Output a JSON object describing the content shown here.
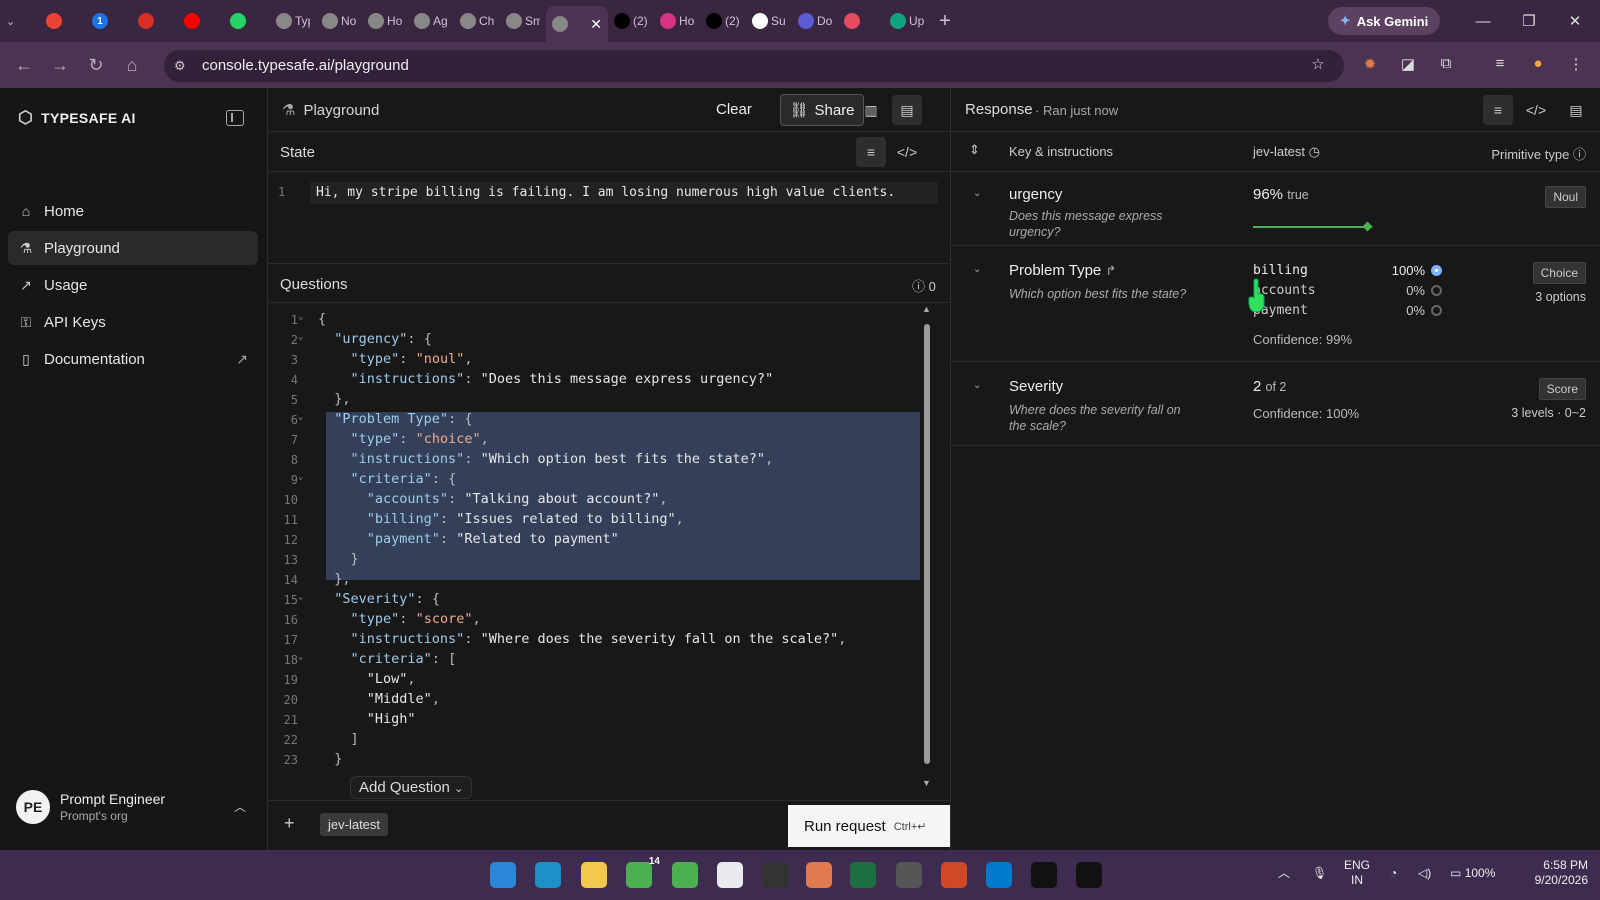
{
  "browser": {
    "tabs": [
      {
        "icon": "gmail-icon",
        "label": "",
        "color": "#ea4335"
      },
      {
        "icon": "badge-icon",
        "label": "",
        "color": "#1a73e8",
        "glyph": "1"
      },
      {
        "icon": "chrome-icon",
        "label": "",
        "color": "#d93025"
      },
      {
        "icon": "youtube-icon",
        "label": "",
        "color": "#ff0000"
      },
      {
        "icon": "whatsapp-icon",
        "label": "",
        "color": "#25d366"
      },
      {
        "icon": "openai-icon",
        "label": "Typ",
        "color": "#888888"
      },
      {
        "icon": "openai-icon",
        "label": "No",
        "color": "#888888"
      },
      {
        "icon": "openai-icon",
        "label": "Ho",
        "color": "#888888"
      },
      {
        "icon": "openai-icon",
        "label": "Age",
        "color": "#888888"
      },
      {
        "icon": "openai-icon",
        "label": "Cho",
        "color": "#888888"
      },
      {
        "icon": "openai-icon",
        "label": "Sm",
        "color": "#888888"
      },
      {
        "icon": "typesafe-icon",
        "label": "",
        "color": "#888888",
        "active": true
      },
      {
        "icon": "x-icon",
        "label": "(2)",
        "color": "#000000"
      },
      {
        "icon": "circle-icon",
        "label": "Ho",
        "color": "#d63384"
      },
      {
        "icon": "x-icon",
        "label": "(2)",
        "color": "#000000"
      },
      {
        "icon": "openai-icon",
        "label": "Suc",
        "color": "#ffffff"
      },
      {
        "icon": "doc-icon",
        "label": "Do",
        "color": "#5b5bd6"
      },
      {
        "icon": "flow-icon",
        "label": "",
        "color": "#e84a5f"
      },
      {
        "icon": "chatgpt-icon",
        "label": "Up",
        "color": "#10a37f"
      }
    ],
    "gemini_label": "Ask Gemini",
    "url": "console.typesafe.ai/playground"
  },
  "sidebar": {
    "brand": "TYPESAFE AI",
    "items": [
      {
        "label": "Home",
        "icon": "home-icon",
        "glyph": "⌂"
      },
      {
        "label": "Playground",
        "icon": "flask-icon",
        "glyph": "⚗",
        "selected": true
      },
      {
        "label": "Usage",
        "icon": "chart-icon",
        "glyph": "↗"
      },
      {
        "label": "API Keys",
        "icon": "key-icon",
        "glyph": "⚿"
      },
      {
        "label": "Documentation",
        "icon": "book-icon",
        "glyph": "▯"
      }
    ],
    "user": {
      "initials": "PE",
      "name": "Prompt Engineer",
      "org": "Prompt's org"
    }
  },
  "playground": {
    "title": "Playground",
    "clear_label": "Clear",
    "share_label": "Share",
    "state_title": "State",
    "state_line_number": "1",
    "state_text": "Hi, my stripe billing is failing. I am losing numerous high value clients.",
    "questions_title": "Questions",
    "questions_count": "0",
    "code_lines": [
      "{",
      "  \"urgency\": {",
      "    \"type\": \"noul\",",
      "    \"instructions\": \"Does this message express urgency?\"",
      "  },",
      "  \"Problem Type\": {",
      "    \"type\": \"choice\",",
      "    \"instructions\": \"Which option best fits the state?\",",
      "    \"criteria\": {",
      "      \"accounts\": \"Talking about account?\",",
      "      \"billing\": \"Issues related to billing\",",
      "      \"payment\": \"Related to payment\"",
      "    }",
      "  },",
      "  \"Severity\": {",
      "    \"type\": \"score\",",
      "    \"instructions\": \"Where does the severity fall on the scale?\",",
      "    \"criteria\": [",
      "      \"Low\",",
      "      \"Middle\",",
      "      \"High\"",
      "    ]",
      "  }"
    ],
    "add_question_label": "Add Question",
    "model_tag": "jev-latest",
    "run_label": "Run request",
    "run_shortcut": "Ctrl+↵"
  },
  "response": {
    "title": "Response",
    "ran": "Ran just now",
    "col_key": "Key & instructions",
    "col_model": "jev-latest",
    "col_type": "Primitive type",
    "rows": {
      "urgency": {
        "key": "urgency",
        "instruction": "Does this message express urgency?",
        "pct": "96%",
        "value": "true",
        "type": "Noul",
        "confidence_level": 0.96
      },
      "problem": {
        "key": "Problem Type",
        "instruction": "Which option best fits the state?",
        "type": "Choice",
        "type_sub": "3 options",
        "options": [
          {
            "label": "billing",
            "pct": "100%",
            "selected": true
          },
          {
            "label": "accounts",
            "pct": "0%",
            "selected": false
          },
          {
            "label": "payment",
            "pct": "0%",
            "selected": false
          }
        ],
        "confidence": "Confidence: 99%"
      },
      "severity": {
        "key": "Severity",
        "instruction": "Where does the severity fall on the scale?",
        "score": "2",
        "of": "of 2",
        "confidence": "Confidence: 100%",
        "type": "Score",
        "type_sub": "3 levels · 0~2"
      }
    }
  },
  "taskbar": {
    "apps": [
      {
        "icon": "windows-icon",
        "color": "#2b88d8"
      },
      {
        "icon": "edge-icon",
        "color": "#1e90c8"
      },
      {
        "icon": "explorer-icon",
        "color": "#f2c94c"
      },
      {
        "icon": "chrome-icon",
        "color": "#4caf50"
      },
      {
        "icon": "chrome-icon",
        "color": "#4caf50"
      },
      {
        "icon": "chrome-icon",
        "color": "#e8eaed"
      },
      {
        "icon": "terminal-icon",
        "color": "#333333"
      },
      {
        "icon": "claude-icon",
        "color": "#e07a4f"
      },
      {
        "icon": "excel-icon",
        "color": "#1d6f42"
      },
      {
        "icon": "chatgpt-icon",
        "color": "#555555"
      },
      {
        "icon": "powerpoint-icon",
        "color": "#d24726"
      },
      {
        "icon": "vscode-icon",
        "color": "#007acc"
      },
      {
        "icon": "capcut-icon",
        "color": "#111111"
      },
      {
        "icon": "capcut-icon",
        "color": "#111111"
      }
    ],
    "lang": "ENG",
    "region": "IN",
    "battery": "100%",
    "time": "6:58 PM",
    "date": "9/20/2026",
    "chrome_badge": "14"
  }
}
